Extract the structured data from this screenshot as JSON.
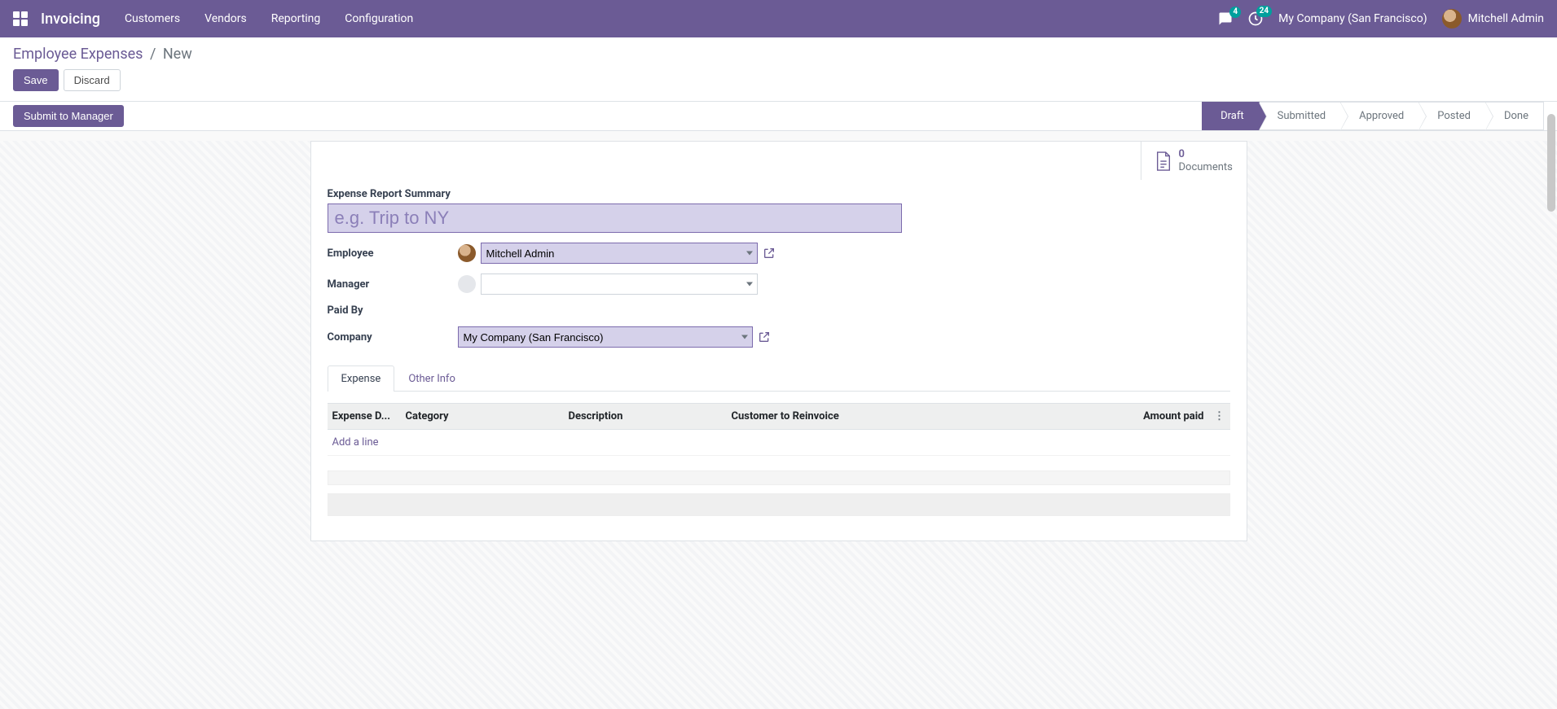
{
  "nav": {
    "app_title": "Invoicing",
    "menu": [
      "Customers",
      "Vendors",
      "Reporting",
      "Configuration"
    ],
    "chat_badge": "4",
    "activity_badge": "24",
    "company": "My Company (San Francisco)",
    "user": "Mitchell Admin"
  },
  "breadcrumb": {
    "parent": "Employee Expenses",
    "current": "New"
  },
  "buttons": {
    "save": "Save",
    "discard": "Discard",
    "submit": "Submit to Manager"
  },
  "status_steps": [
    "Draft",
    "Submitted",
    "Approved",
    "Posted",
    "Done"
  ],
  "status_active_index": 0,
  "stat_button": {
    "count": "0",
    "label": "Documents"
  },
  "form": {
    "summary_label": "Expense Report Summary",
    "summary_placeholder": "e.g. Trip to NY",
    "summary_value": "",
    "employee_label": "Employee",
    "employee_value": "Mitchell Admin",
    "manager_label": "Manager",
    "manager_value": "",
    "paid_by_label": "Paid By",
    "company_label": "Company",
    "company_value": "My Company (San Francisco)"
  },
  "tabs": [
    "Expense",
    "Other Info"
  ],
  "tab_active_index": 0,
  "table": {
    "columns": [
      "Expense D...",
      "Category",
      "Description",
      "Customer to Reinvoice",
      "",
      "Amount paid"
    ],
    "add_line": "Add a line"
  }
}
